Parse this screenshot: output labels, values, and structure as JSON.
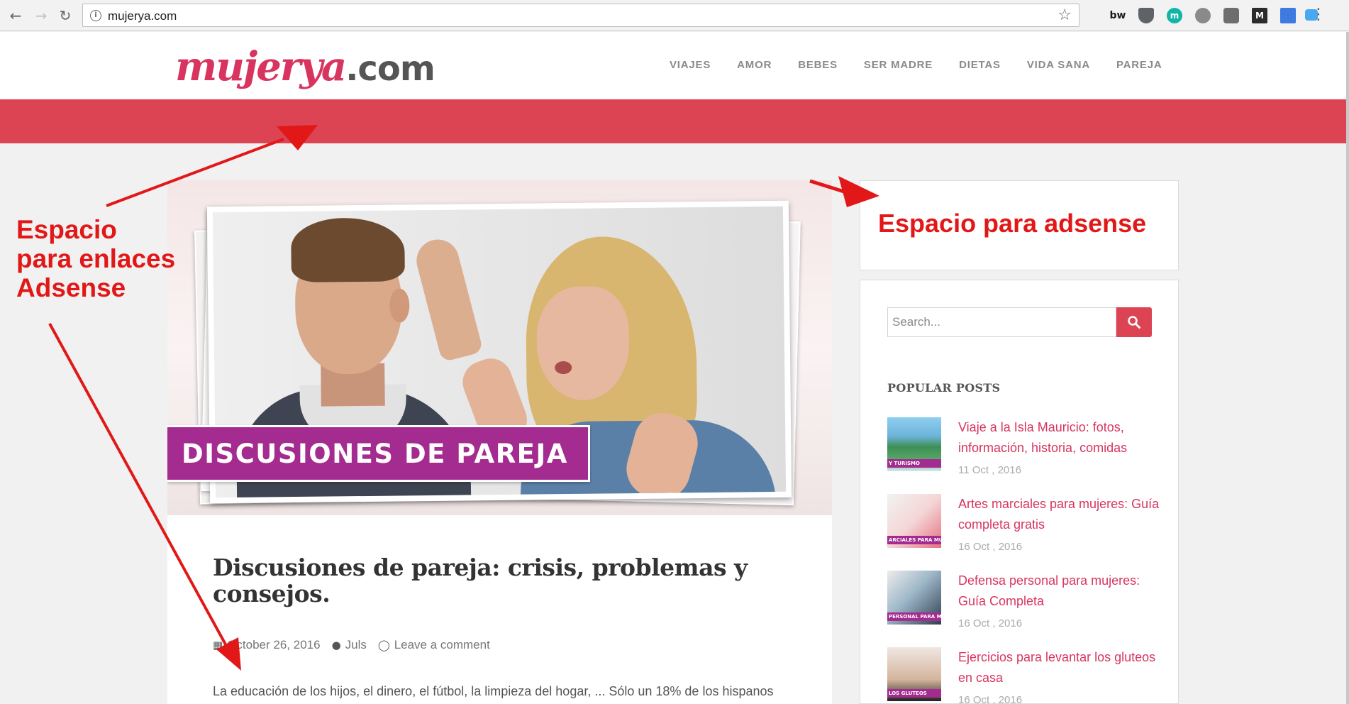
{
  "browser": {
    "url": "mujerya.com",
    "back_icon": "←",
    "forward_icon": "→",
    "reload_icon": "↻",
    "star_icon": "☆",
    "extensions": [
      "bw",
      "ublock",
      "m",
      "x",
      "camera",
      "M",
      "fb",
      "cast"
    ],
    "menu_icon": "⋮"
  },
  "site": {
    "logo_main": "mujerya",
    "logo_dot": ".com",
    "nav": [
      "VIAJES",
      "AMOR",
      "BEBES",
      "SER MADRE",
      "DIETAS",
      "VIDA SANA",
      "PAREJA"
    ]
  },
  "post": {
    "banner": "DISCUSIONES DE PAREJA",
    "title": "Discusiones de pareja: crisis, problemas y consejos.",
    "date": "October 26, 2016",
    "author": "Juls",
    "comment": "Leave a comment",
    "excerpt": "La educación de los hijos, el dinero, el fútbol, la limpieza del hogar, ... Sólo un 18% de los hispanos"
  },
  "sidebar": {
    "search_placeholder": "Search...",
    "popular_heading": "POPULAR POSTS",
    "posts": [
      {
        "title": "Viaje a la Isla Mauricio: fotos, información, historia, comidas",
        "date": "11 Oct , 2016",
        "thumb_label": "Y TURISMO"
      },
      {
        "title": "Artes marciales para mujeres: Guía completa gratis",
        "date": "16 Oct , 2016",
        "thumb_label": "ARCIALES PARA MUJ"
      },
      {
        "title": "Defensa personal para mujeres: Guía Completa",
        "date": "16 Oct , 2016",
        "thumb_label": "PERSONAL PARA MU"
      },
      {
        "title": "Ejercicios para levantar los gluteos en casa",
        "date": "16 Oct , 2016",
        "thumb_label": "LOS GLUTEOS"
      }
    ]
  },
  "annotations": {
    "left_line1": "Espacio",
    "left_line2": "para enlaces",
    "left_line3": "Adsense",
    "right": "Espacio para adsense"
  },
  "colors": {
    "brand": "#d8345f",
    "band": "#dc4353",
    "annotation": "#e21818",
    "banner": "#a42b8f"
  }
}
